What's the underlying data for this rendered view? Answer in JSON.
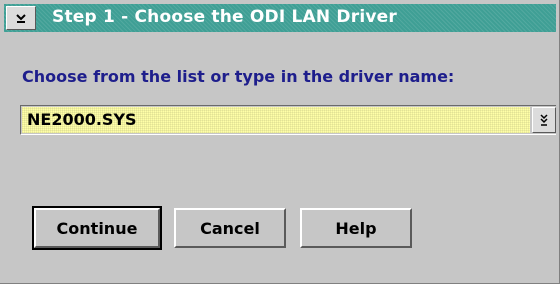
{
  "window": {
    "title": "Step 1 - Choose the ODI LAN Driver",
    "sysmenu_icon": "system-menu-icon"
  },
  "prompt": {
    "text": "Choose from the list or type in the driver name:"
  },
  "driver_combo": {
    "value": "NE2000.SYS",
    "dropdown_icon": "dropdown-arrow-icon"
  },
  "buttons": {
    "continue_label": "Continue",
    "cancel_label": "Cancel",
    "help_label": "Help"
  },
  "colors": {
    "titlebar": "#3f9f95",
    "prompt_text": "#1e1e8c",
    "field_bg": "#ffffa8",
    "dialog_bg": "#c6c6c6"
  }
}
